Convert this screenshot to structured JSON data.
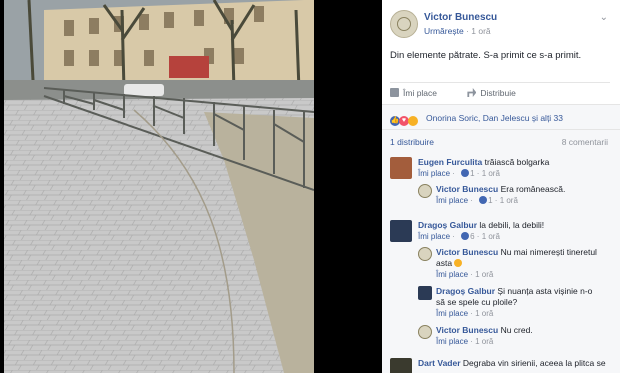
{
  "post": {
    "author": "Victor Bunescu",
    "follow": "Urmărește",
    "time": "1 oră",
    "text": "Din elemente pătrate. S-a primit ce s-a primit.",
    "chevron": "chevron-down-icon"
  },
  "actions": {
    "like": "Îmi place",
    "share": "Distribuie"
  },
  "reactions": {
    "text": "Onorina Soric, Dan Jelescu și alți 33"
  },
  "counts": {
    "shares": "1 distribuire",
    "comments": "8 comentarii"
  },
  "comments": [
    {
      "author": "Eugen Furculita",
      "text": "trăiască bolgarka",
      "like": "Îmi place",
      "count": "1",
      "time": "1 oră"
    },
    {
      "author": "Victor Bunescu",
      "text": "Era românească.",
      "like": "Îmi place",
      "count": "1",
      "time": "1 oră"
    },
    {
      "author": "Dragoș Galbur",
      "text": "la debili, la debili!",
      "like": "Îmi place",
      "count": "6",
      "time": "1 oră"
    },
    {
      "author": "Victor Bunescu",
      "text": "Nu mai nimerești tineretul",
      "text2": "asta",
      "like": "Îmi place",
      "time": "1 oră"
    },
    {
      "author": "Dragoș Galbur",
      "text": "Și nuanța asta vișinie n-o",
      "text2": "să se spele cu ploile?",
      "like": "Îmi place",
      "time": "1 oră"
    },
    {
      "author": "Victor Bunescu",
      "text": "Nu cred.",
      "like": "Îmi place",
      "time": "1 oră"
    },
    {
      "author": "Dart Vader",
      "text": "Degraba vin sirienii, aceea la plitca se"
    }
  ]
}
